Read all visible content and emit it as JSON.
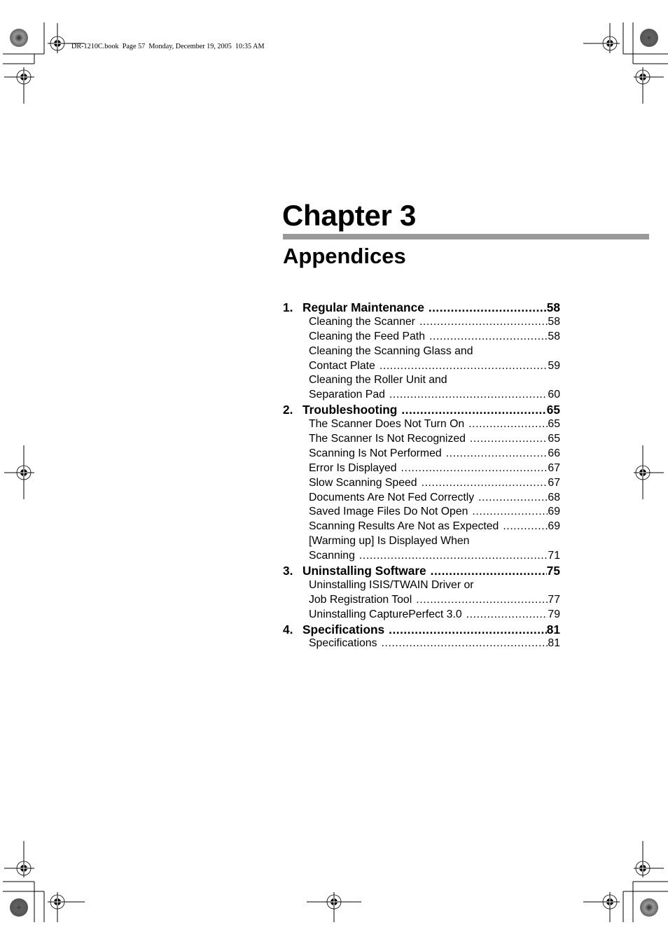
{
  "header": {
    "print_slug": "DR-1210C.book  Page 57  Monday, December 19, 2005  10:35 AM"
  },
  "chapter": {
    "title": "Chapter 3",
    "subtitle": "Appendices",
    "rule_color": "#999999"
  },
  "toc": [
    {
      "level": "main",
      "number": "1.",
      "label": "Regular Maintenance",
      "page": "58"
    },
    {
      "level": "sub",
      "label": "Cleaning the Scanner",
      "page": "58"
    },
    {
      "level": "sub",
      "label": "Cleaning the Feed Path",
      "page": "58"
    },
    {
      "level": "sub",
      "label": "Cleaning the Scanning Glass and",
      "page": ""
    },
    {
      "level": "sub",
      "label": "Contact Plate",
      "page": "59"
    },
    {
      "level": "sub",
      "label": "Cleaning the Roller Unit and",
      "page": ""
    },
    {
      "level": "sub",
      "label": "Separation Pad",
      "page": "60"
    },
    {
      "level": "main",
      "number": "2.",
      "label": "Troubleshooting",
      "page": "65"
    },
    {
      "level": "sub",
      "label": "The Scanner Does Not Turn On",
      "page": "65"
    },
    {
      "level": "sub",
      "label": "The Scanner Is Not Recognized",
      "page": "65"
    },
    {
      "level": "sub",
      "label": "Scanning Is Not Performed",
      "page": "66"
    },
    {
      "level": "sub",
      "label": "Error Is Displayed",
      "page": "67"
    },
    {
      "level": "sub",
      "label": "Slow Scanning Speed",
      "page": "67"
    },
    {
      "level": "sub",
      "label": "Documents Are Not Fed Correctly",
      "page": "68"
    },
    {
      "level": "sub",
      "label": "Saved Image Files Do Not Open",
      "page": "69"
    },
    {
      "level": "sub",
      "label": "Scanning Results Are Not as Expected",
      "page": "69"
    },
    {
      "level": "sub",
      "label": "[Warming up] Is Displayed When",
      "page": ""
    },
    {
      "level": "sub",
      "label": "Scanning",
      "page": "71"
    },
    {
      "level": "main",
      "number": "3.",
      "label": "Uninstalling Software",
      "page": "75"
    },
    {
      "level": "sub",
      "label": "Uninstalling ISIS/TWAIN Driver or",
      "page": ""
    },
    {
      "level": "sub",
      "label": "Job Registration Tool",
      "page": "77"
    },
    {
      "level": "sub",
      "label": "Uninstalling CapturePerfect 3.0",
      "page": "79"
    },
    {
      "level": "main",
      "number": "4.",
      "label": "Specifications",
      "page": "81"
    },
    {
      "level": "sub",
      "label": "Specifications",
      "page": "81"
    }
  ],
  "icons": {
    "registration_mark": "registration-target-icon",
    "color_target": "color-calibration-target-icon"
  }
}
